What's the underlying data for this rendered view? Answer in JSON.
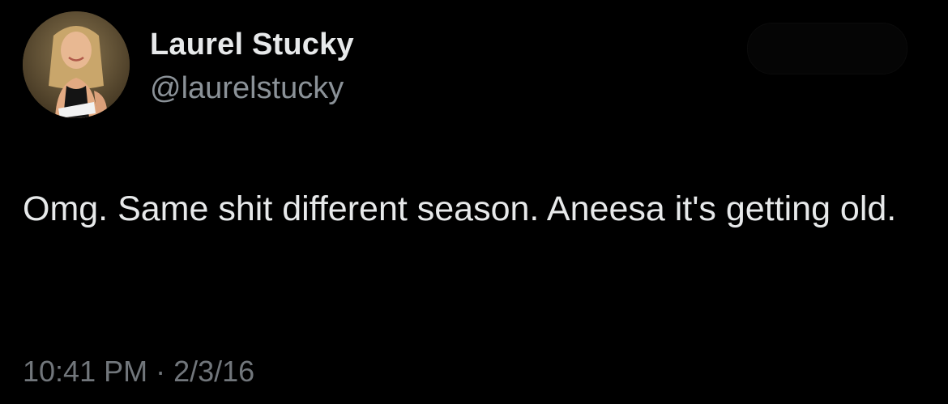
{
  "tweet": {
    "author": {
      "display_name": "Laurel Stucky",
      "handle": "@laurelstucky",
      "avatar_icon": "profile-photo-avatar"
    },
    "text": "Omg. Same shit different season. Aneesa it's getting old.",
    "time": "10:41 PM",
    "separator": "·",
    "date": "2/3/16"
  },
  "colors": {
    "background": "#000000",
    "primary_text": "#e7e9ea",
    "secondary_text": "#71767b"
  }
}
